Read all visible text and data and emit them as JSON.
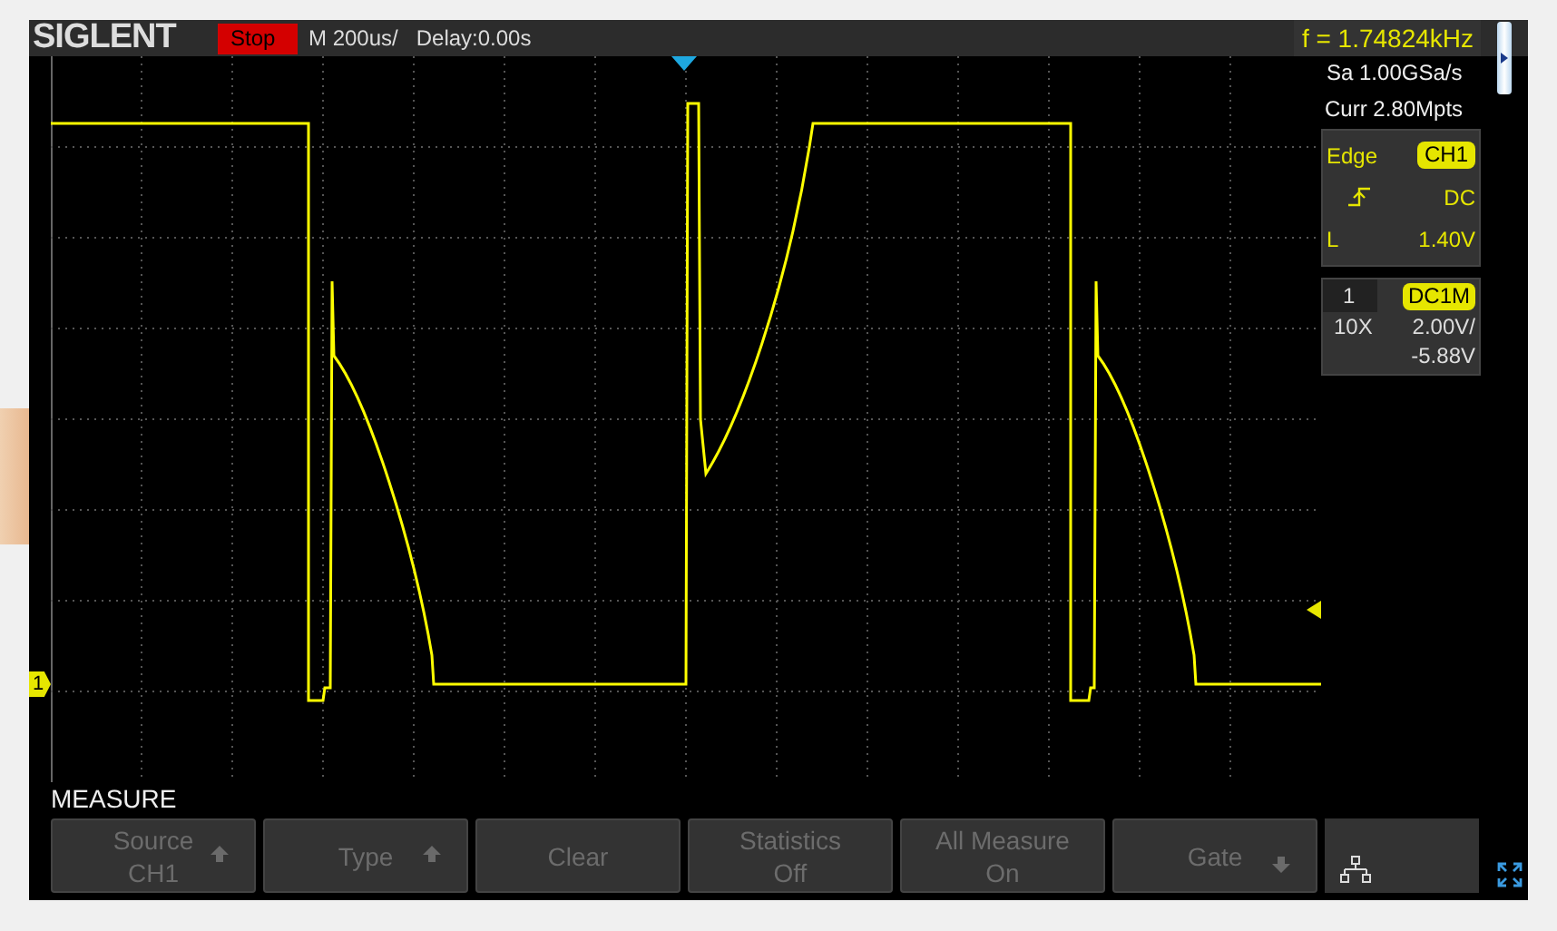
{
  "header": {
    "brand": "SIGLENT",
    "run_state": "Stop",
    "timebase": "M 200us/",
    "delay": "Delay:0.00s",
    "frequency": "f = 1.74824kHz"
  },
  "acquisition": {
    "sample_rate": "Sa 1.00GSa/s",
    "memory": "Curr 2.80Mpts"
  },
  "trigger": {
    "type": "Edge",
    "source": "CH1",
    "coupling": "DC",
    "level_label": "L",
    "level": "1.40V"
  },
  "channel": {
    "number": "1",
    "coupling": "DC1M",
    "probe": "10X",
    "scale": "2.00V/",
    "offset": "-5.88V",
    "marker": "1"
  },
  "menu": {
    "title": "MEASURE",
    "buttons": [
      {
        "label": "Source",
        "value": "CH1",
        "kind": "up"
      },
      {
        "label": "Type",
        "kind": "up"
      },
      {
        "label": "Clear",
        "kind": "plain"
      },
      {
        "label": "Statistics",
        "value": "Off",
        "kind": "plain"
      },
      {
        "label": "All Measure",
        "value": "On",
        "kind": "plain"
      },
      {
        "label": "Gate",
        "kind": "down"
      }
    ]
  }
}
